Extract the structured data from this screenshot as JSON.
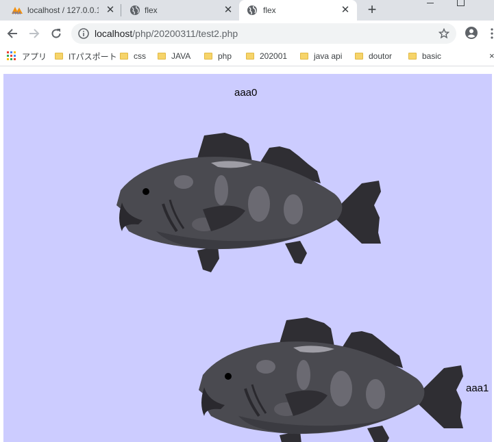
{
  "browser": {
    "tabs": [
      {
        "title": "localhost / 127.0.0.1",
        "icon": "phpmyadmin-icon",
        "active": false
      },
      {
        "title": "flex",
        "icon": "globe-icon",
        "active": false
      },
      {
        "title": "flex",
        "icon": "globe-icon",
        "active": true
      }
    ],
    "url_host": "localhost",
    "url_path": "/php/20200311/test2.php",
    "bookmarks": [
      {
        "label": "アプリ",
        "icon": "apps-grid-icon"
      },
      {
        "label": "ITパスポート",
        "icon": "folder-icon"
      },
      {
        "label": "css",
        "icon": "folder-icon"
      },
      {
        "label": "JAVA",
        "icon": "folder-icon"
      },
      {
        "label": "php",
        "icon": "folder-icon"
      },
      {
        "label": "202001",
        "icon": "folder-icon"
      },
      {
        "label": "java api",
        "icon": "folder-icon"
      },
      {
        "label": "doutor",
        "icon": "folder-icon"
      },
      {
        "label": "basic",
        "icon": "folder-icon"
      }
    ]
  },
  "page": {
    "background": "#ccccff",
    "items": [
      {
        "label": "aaa0"
      },
      {
        "label": "aaa1"
      }
    ]
  }
}
